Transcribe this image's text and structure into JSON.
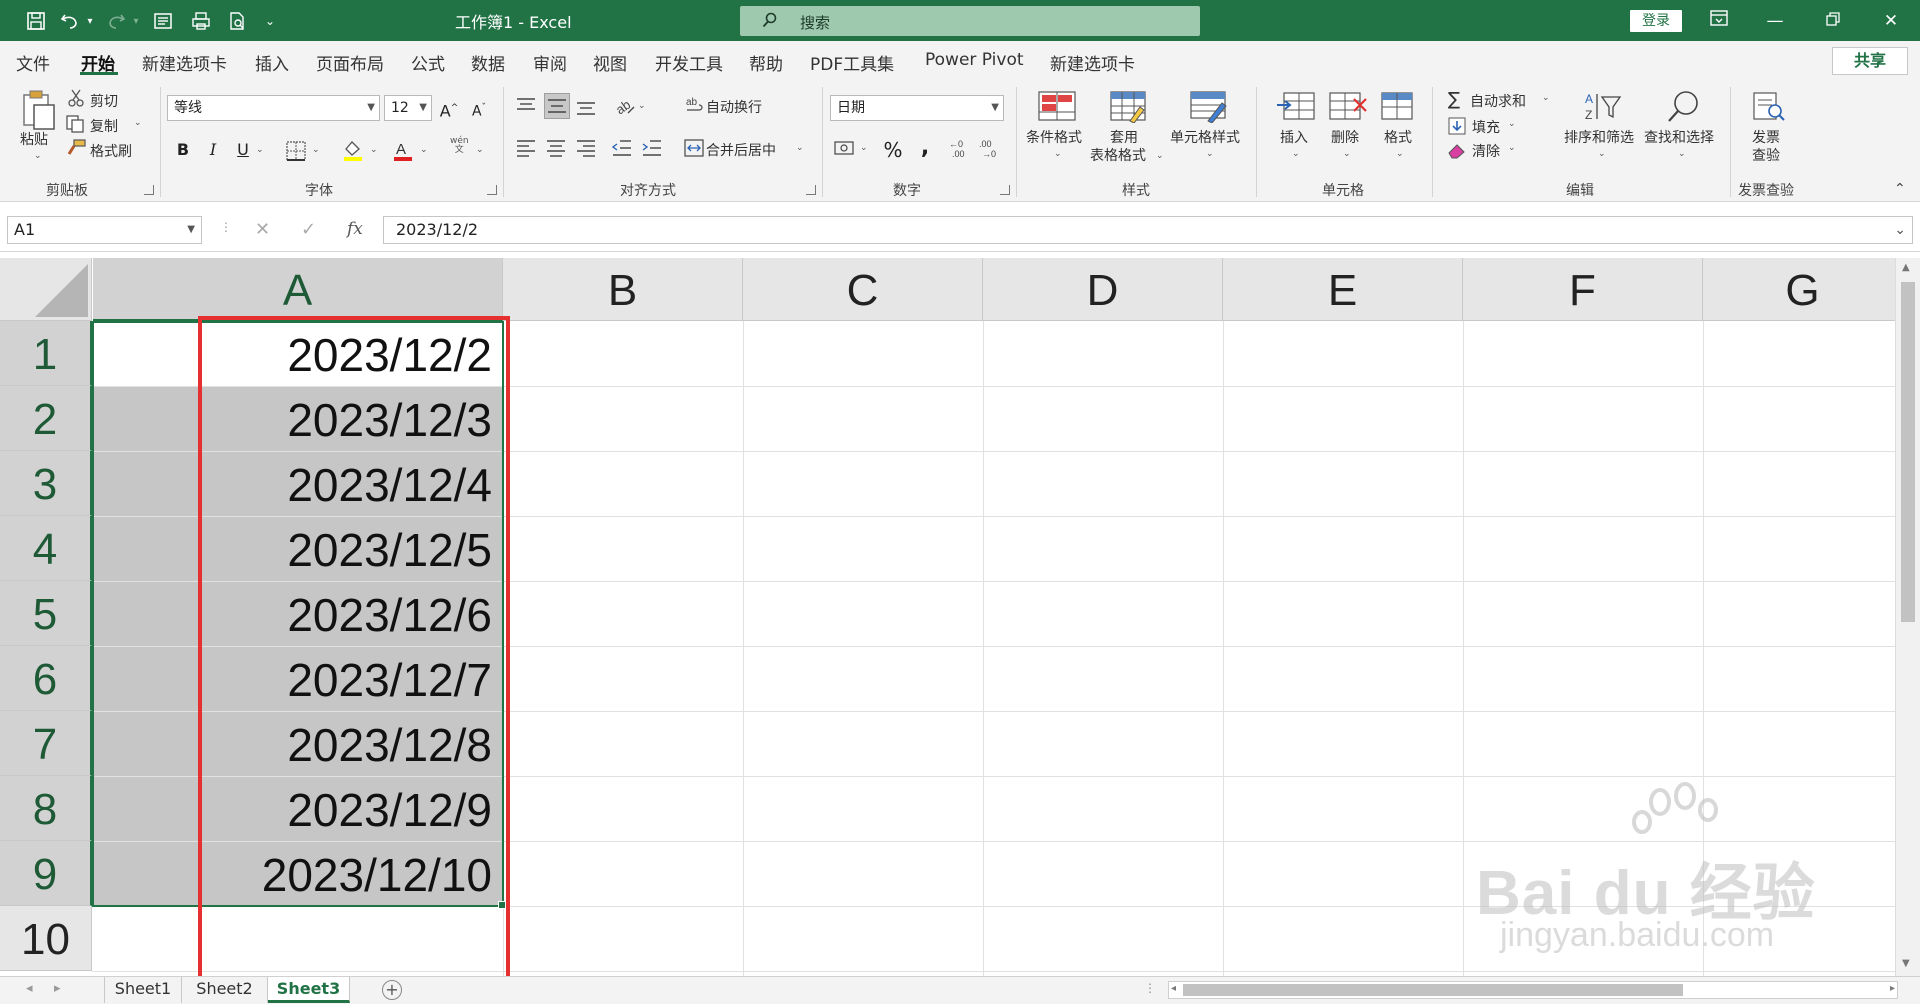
{
  "window": {
    "title": "工作簿1  -  Excel",
    "search_placeholder": "搜索",
    "login_label": "登录"
  },
  "menu": {
    "tabs": [
      "文件",
      "开始",
      "新建选项卡",
      "插入",
      "页面布局",
      "公式",
      "数据",
      "审阅",
      "视图",
      "开发工具",
      "帮助",
      "PDF工具集",
      "Power Pivot",
      "新建选项卡"
    ],
    "active_tab": "开始",
    "share_label": "共享"
  },
  "ribbon": {
    "clipboard": {
      "paste": "粘贴",
      "cut": "剪切",
      "copy": "复制",
      "format_painter": "格式刷",
      "group": "剪贴板"
    },
    "font": {
      "name": "等线",
      "size": "12",
      "group": "字体",
      "bold": "B",
      "italic": "I",
      "underline": "U",
      "pinyin_top": "wén",
      "pinyin_bottom": "文"
    },
    "alignment": {
      "wrap": "自动换行",
      "merge": "合并后居中",
      "group": "对齐方式"
    },
    "number": {
      "format": "日期",
      "group": "数字",
      "percent": "%",
      "comma": ","
    },
    "styles": {
      "conditional": "条件格式",
      "table_1": "套用",
      "table_2": "表格格式",
      "cell_styles": "单元格样式",
      "group": "样式"
    },
    "cells": {
      "insert": "插入",
      "delete": "删除",
      "format": "格式",
      "group": "单元格"
    },
    "editing": {
      "autosum": "自动求和",
      "fill": "填充",
      "clear": "清除",
      "sort": "排序和筛选",
      "find": "查找和选择",
      "group": "编辑"
    },
    "invoice": {
      "check_1": "发票",
      "check_2": "查验",
      "group": "发票查验"
    }
  },
  "formula_bar": {
    "name_box": "A1",
    "formula": "2023/12/2",
    "fx": "fx"
  },
  "grid": {
    "columns": [
      "A",
      "B",
      "C",
      "D",
      "E",
      "F",
      "G"
    ],
    "rows": [
      "1",
      "2",
      "3",
      "4",
      "5",
      "6",
      "7",
      "8",
      "9",
      "10"
    ],
    "column_a_values": [
      "2023/12/2",
      "2023/12/3",
      "2023/12/4",
      "2023/12/5",
      "2023/12/6",
      "2023/12/7",
      "2023/12/8",
      "2023/12/9",
      "2023/12/10"
    ]
  },
  "sheets": {
    "tabs": [
      "Sheet1",
      "Sheet2",
      "Sheet3"
    ],
    "active": "Sheet3",
    "add_label": "+"
  },
  "watermark": {
    "main": "Bai du 经验",
    "sub": "jingyan.baidu.com"
  },
  "colors": {
    "accent": "#217346",
    "highlight_box": "#e5302f",
    "selection_fill": "#c6c6c6"
  }
}
